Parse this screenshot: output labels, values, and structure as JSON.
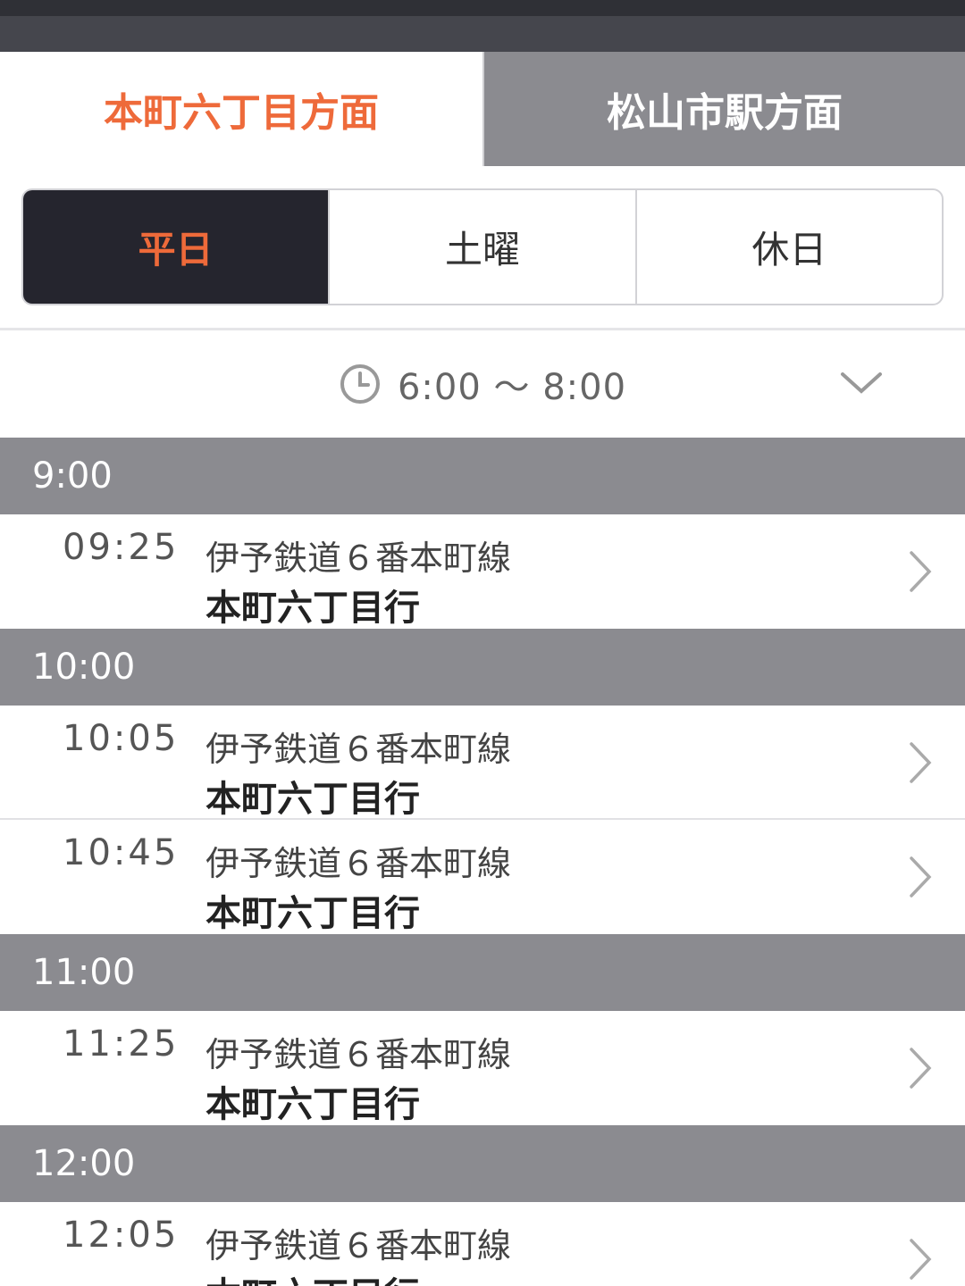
{
  "direction_tabs": [
    {
      "label": "本町六丁目方面",
      "active": true
    },
    {
      "label": "松山市駅方面",
      "active": false
    }
  ],
  "day_tabs": [
    {
      "label": "平日",
      "active": true
    },
    {
      "label": "土曜",
      "active": false
    },
    {
      "label": "休日",
      "active": false
    }
  ],
  "time_range": {
    "label": "6:00 〜 8:00",
    "icon": "clock-icon",
    "expand_icon": "chevron-down-icon"
  },
  "colors": {
    "accent": "#ee6a3a",
    "header_gray": "#8b8b90",
    "active_dark": "#25252e"
  },
  "schedule": [
    {
      "hour": "9:00",
      "departures": [
        {
          "time": "09:25",
          "line": "伊予鉄道６番本町線",
          "dest": "本町六丁目行"
        }
      ]
    },
    {
      "hour": "10:00",
      "departures": [
        {
          "time": "10:05",
          "line": "伊予鉄道６番本町線",
          "dest": "本町六丁目行"
        },
        {
          "time": "10:45",
          "line": "伊予鉄道６番本町線",
          "dest": "本町六丁目行"
        }
      ]
    },
    {
      "hour": "11:00",
      "departures": [
        {
          "time": "11:25",
          "line": "伊予鉄道６番本町線",
          "dest": "本町六丁目行"
        }
      ]
    },
    {
      "hour": "12:00",
      "departures": [
        {
          "time": "12:05",
          "line": "伊予鉄道６番本町線",
          "dest": "本町六丁目行"
        }
      ]
    }
  ]
}
